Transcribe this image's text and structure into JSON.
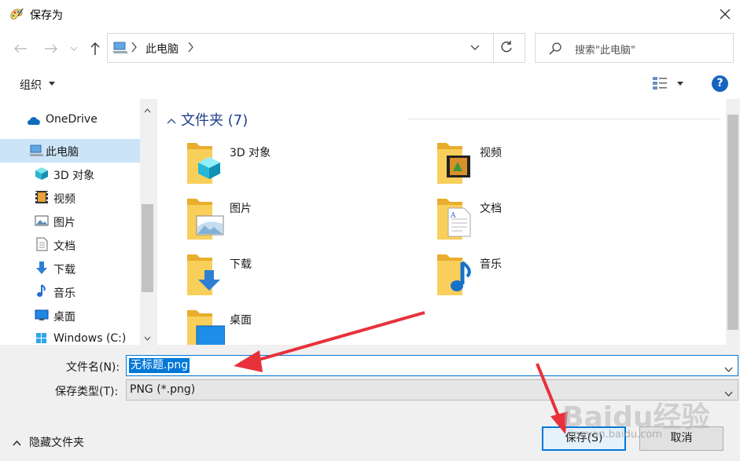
{
  "window": {
    "title": "保存为"
  },
  "address": {
    "path": "此电脑"
  },
  "search": {
    "placeholder": "搜索\"此电脑\""
  },
  "toolbar": {
    "organize_label": "组织",
    "help": "?"
  },
  "sidebar": {
    "items": [
      {
        "label": "OneDrive",
        "icon": "cloud-icon"
      },
      {
        "label": "此电脑",
        "icon": "computer-icon",
        "selected": true
      },
      {
        "label": "3D 对象",
        "icon": "cube-icon"
      },
      {
        "label": "视频",
        "icon": "video-icon"
      },
      {
        "label": "图片",
        "icon": "picture-icon"
      },
      {
        "label": "文档",
        "icon": "document-icon"
      },
      {
        "label": "下载",
        "icon": "download-icon"
      },
      {
        "label": "音乐",
        "icon": "music-icon"
      },
      {
        "label": "桌面",
        "icon": "desktop-icon"
      },
      {
        "label": "Windows (C:)",
        "icon": "drive-icon"
      }
    ]
  },
  "content": {
    "group_title": "文件夹 (7)",
    "folders": [
      {
        "label": "3D 对象",
        "overlay": "cube"
      },
      {
        "label": "视频",
        "overlay": "film"
      },
      {
        "label": "图片",
        "overlay": "picture"
      },
      {
        "label": "文档",
        "overlay": "document"
      },
      {
        "label": "下载",
        "overlay": "download"
      },
      {
        "label": "音乐",
        "overlay": "music"
      },
      {
        "label": "桌面",
        "overlay": "desktop"
      }
    ]
  },
  "form": {
    "filename_label": "文件名(N):",
    "filename_value": "无标题.png",
    "filetype_label": "保存类型(T):",
    "filetype_value": "PNG (*.png)"
  },
  "footer": {
    "hide_folders_label": "隐藏文件夹",
    "save_label": "保存(S)",
    "cancel_label": "取消"
  },
  "colors": {
    "accent": "#0078d7",
    "folder": "#f5c445",
    "annotation": "#e8313b"
  },
  "watermark": {
    "brand": "Baidu经验",
    "url": "jingyan.baidu.com"
  }
}
